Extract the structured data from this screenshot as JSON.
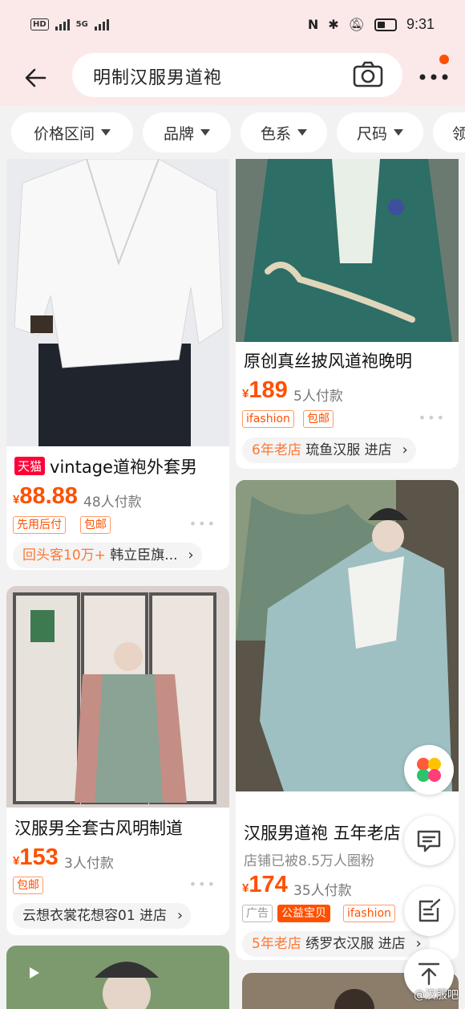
{
  "status_bar": {
    "network": "HD",
    "net2": "5G",
    "time": "9:31"
  },
  "search": {
    "query": "明制汉服男道袍"
  },
  "filters": [
    "价格区间",
    "品牌",
    "色系",
    "尺码",
    "领"
  ],
  "products": [
    {
      "badge": "天猫",
      "title": "vintage道袍外套男",
      "price": "88.88",
      "sold": "48人付款",
      "tags": [
        "先用后付",
        "包邮"
      ],
      "shop_highlight": "回头客10万+",
      "shop_name": "韩立臣旗..."
    },
    {
      "title": "原创真丝披风道袍晚明",
      "price": "189",
      "sold": "5人付款",
      "tags": [
        "ifashion",
        "包邮"
      ],
      "shop_highlight": "6年老店",
      "shop_name": "琉鱼汉服 进店"
    },
    {
      "title": "汉服男全套古风明制道",
      "price": "153",
      "sold": "3人付款",
      "tags": [
        "包邮"
      ],
      "shop_name": "云想衣裳花想容01 进店"
    },
    {
      "title": "汉服男道袍 五年老店",
      "subtitle": "店铺已被8.5万人圈粉",
      "price": "174",
      "sold": "35人付款",
      "tags": [
        "广告",
        "公益宝贝",
        "ifashion"
      ],
      "shop_highlight": "5年老店",
      "shop_name": "绣罗衣汉服 进店"
    }
  ],
  "currency": "¥",
  "watermark": "@汉服吧"
}
